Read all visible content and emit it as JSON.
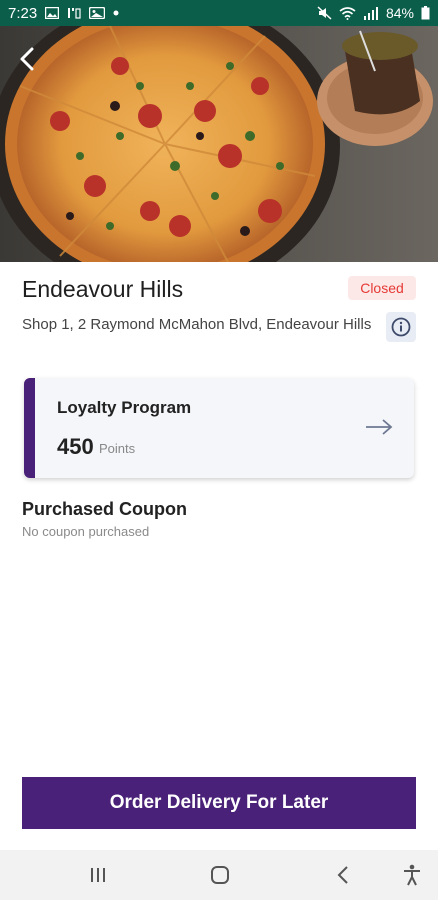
{
  "status_bar": {
    "time": "7:23",
    "battery": "84%",
    "icons": [
      "gallery-icon",
      "notification-icon",
      "image-icon",
      "dot-icon",
      "mute-icon",
      "wifi-icon",
      "signal-icon",
      "battery-icon"
    ]
  },
  "hero": {
    "back_icon": "chevron-left-icon"
  },
  "store": {
    "name": "Endeavour Hills",
    "status": "Closed",
    "address": "Shop 1, 2 Raymond McMahon Blvd, Endeavour Hills",
    "info_icon": "info-icon"
  },
  "loyalty": {
    "title": "Loyalty Program",
    "points": "450",
    "points_unit": "Points",
    "arrow_icon": "arrow-right-icon"
  },
  "coupon": {
    "title": "Purchased Coupon",
    "empty_text": "No coupon purchased"
  },
  "order_button": {
    "label": "Order Delivery For Later"
  },
  "colors": {
    "status_bar": "#0b5e4a",
    "brand_purple": "#4a2178",
    "closed_red": "#e53935",
    "closed_bg": "#fde8e8"
  },
  "navbar": {
    "icons": [
      "recent-apps-icon",
      "home-icon",
      "back-icon",
      "accessibility-icon"
    ]
  }
}
